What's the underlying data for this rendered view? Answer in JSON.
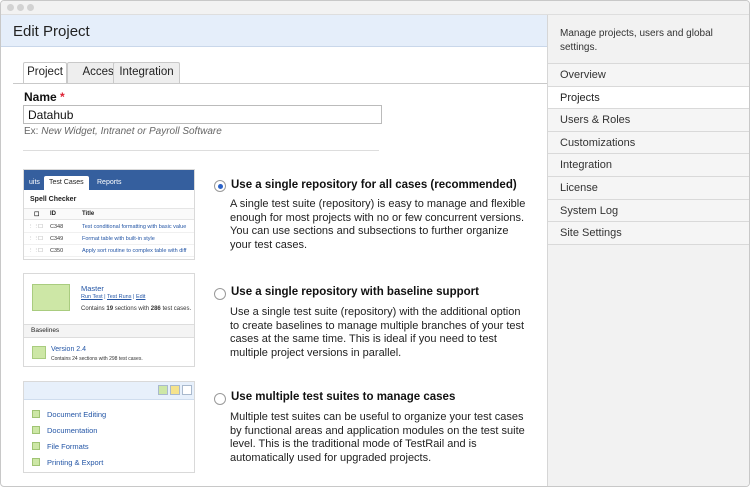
{
  "header": {
    "title": "Edit Project"
  },
  "sidebar": {
    "intro": "Manage projects, users and global settings.",
    "items": [
      {
        "label": "Overview"
      },
      {
        "label": "Projects"
      },
      {
        "label": "Users & Roles"
      },
      {
        "label": "Customizations"
      },
      {
        "label": "Integration"
      },
      {
        "label": "License"
      },
      {
        "label": "System Log"
      },
      {
        "label": "Site Settings"
      }
    ],
    "active": "Projects"
  },
  "tabs": [
    {
      "label": "Project"
    },
    {
      "label": "Access"
    },
    {
      "label": "Integration"
    }
  ],
  "form": {
    "name_label": "Name",
    "required_mark": "*",
    "name_value": "Datahub",
    "hint_prefix": "Ex:",
    "hint_examples": "New Widget, Intranet or Payroll Software"
  },
  "thumb1": {
    "tabs": [
      "uits",
      "Test Cases",
      "Reports"
    ],
    "title": "Spell Checker",
    "col_id": "ID",
    "col_title": "Title",
    "rows": [
      {
        "id": "C348",
        "title": "Test conditional formatting with basic value"
      },
      {
        "id": "C349",
        "title": "Format table with built-in style"
      },
      {
        "id": "C350",
        "title": "Apply sort routine to complex table with diff"
      }
    ]
  },
  "thumb2": {
    "master": "Master",
    "links": [
      "Run Test",
      "Test Runs",
      "Edit"
    ],
    "contains_prefix": "Contains",
    "sections": "19",
    "contains_mid": "sections with",
    "cases": "286",
    "contains_suffix": "test cases.",
    "baselines_label": "Baselines",
    "version": "Version 2.4",
    "version_contains": "Contains 24 sections with 298 test cases."
  },
  "thumb3": {
    "items": [
      "Document Editing",
      "Documentation",
      "File Formats",
      "Printing & Export"
    ]
  },
  "options": [
    {
      "title": "Use a single repository for all cases (recommended)",
      "description": "A single test suite (repository) is easy to manage and flexible enough for most projects with no or few concurrent versions. You can use sections and subsections to further organize your test cases.",
      "selected": true
    },
    {
      "title": "Use a single repository with baseline support",
      "description": "Use a single test suite (repository) with the additional option to create baselines to manage multiple branches of your test cases at the same time. This is ideal if you need to test multiple project versions in parallel.",
      "selected": false
    },
    {
      "title": "Use multiple test suites to manage cases",
      "description": "Multiple test suites can be useful to organize your test cases by functional areas and application modules on the test suite level. This is the traditional mode of TestRail and is automatically used for upgraded projects.",
      "selected": false
    }
  ],
  "colors": {
    "header_bg": "#e5eefa",
    "accent_blue": "#355f9e",
    "link_blue": "#2456a6",
    "required_red": "#dd2233",
    "thumb_green": "#cde7a6"
  }
}
